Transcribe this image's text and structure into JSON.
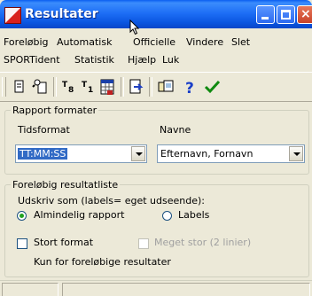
{
  "window": {
    "title": "Resultater"
  },
  "menus": {
    "row1": [
      "Foreløbig",
      "Automatisk",
      "Officielle",
      "Vindere",
      "Slet"
    ],
    "row2": [
      "SPORTident",
      "Statistik",
      "Hjælp",
      "Luk"
    ]
  },
  "toolbar": {
    "buttons": [
      "print-icon",
      "print-preview-icon",
      "sort-icon",
      "sort-one-icon",
      "calendar-icon",
      "export-icon",
      "copy-icon",
      "help-icon",
      "ok-icon"
    ],
    "help_glyph": "?"
  },
  "rapport": {
    "group_label": "Rapport formater",
    "time_label": "Tidsformat",
    "time_value": "TT:MM:SS",
    "name_label": "Navne",
    "name_value": "Efternavn, Fornavn"
  },
  "resultat": {
    "group_label": "Foreløbig resultatliste",
    "print_as_label": "Udskriv som (labels= eget udseende):",
    "radio_normal": "Almindelig rapport",
    "radio_labels": "Labels",
    "selected": "normal",
    "stort_format": "Stort format",
    "meget_stor": "Meget stor (2 linier)",
    "note": "Kun for foreløbige resultater"
  }
}
